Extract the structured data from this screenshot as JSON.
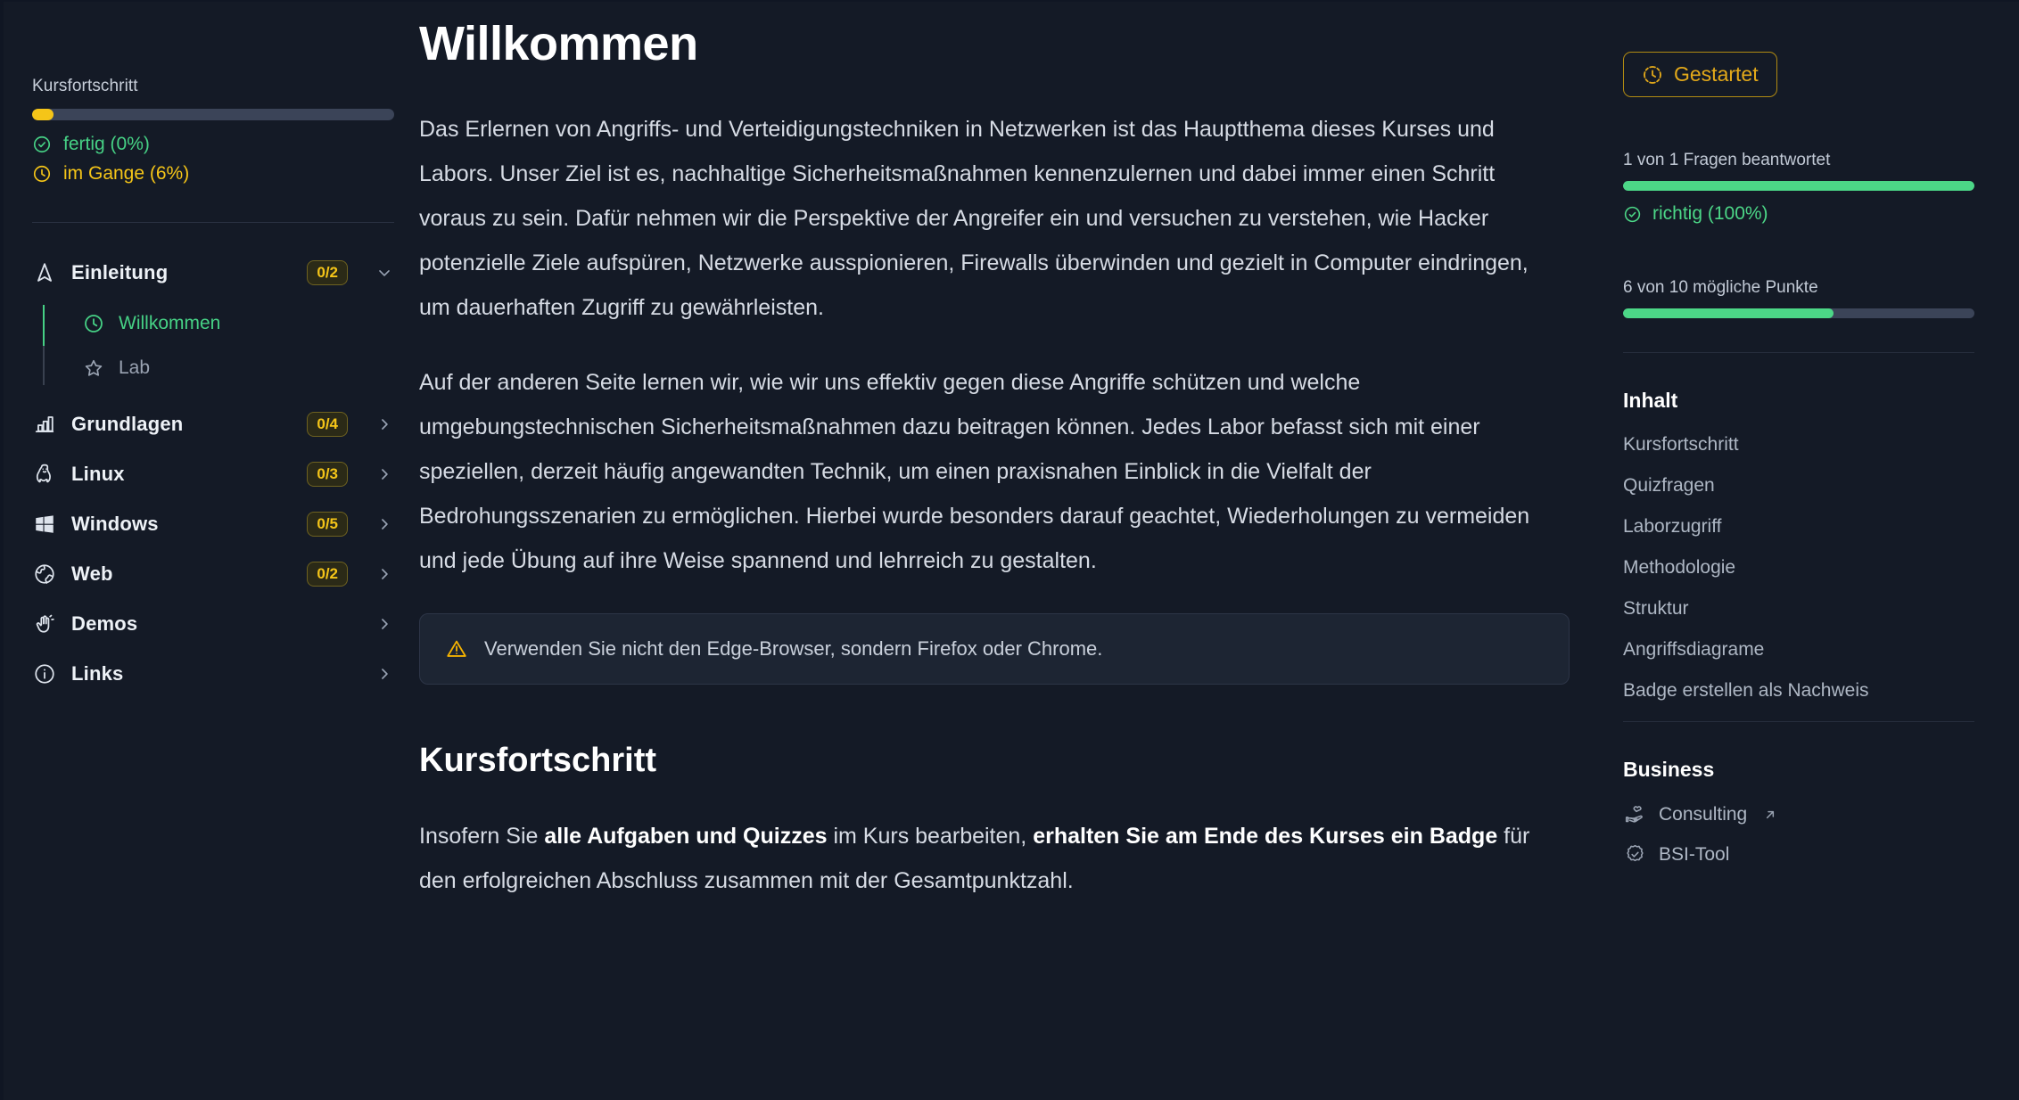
{
  "course_progress": {
    "label": "Kursfortschritt",
    "bar_percent": 6,
    "done_text": "fertig (0%)",
    "inprogress_text": "im Gange (6%)",
    "done_icon": "check-circle-icon",
    "inprogress_icon": "clock-icon",
    "colors": {
      "done": "#46d185",
      "inprogress": "#f5c518",
      "track": "#3b4458"
    }
  },
  "nav": {
    "items": [
      {
        "label": "Einleitung",
        "icon": "navigation-arrow-icon",
        "count": "0/2",
        "chevron": "chevron-down-icon",
        "expanded": true,
        "children": [
          {
            "label": "Willkommen",
            "icon": "clock-icon",
            "state": "active"
          },
          {
            "label": "Lab",
            "icon": "star-icon",
            "state": "idle"
          }
        ]
      },
      {
        "label": "Grundlagen",
        "icon": "bar-chart-icon",
        "count": "0/4",
        "chevron": "chevron-right-icon",
        "expanded": false
      },
      {
        "label": "Linux",
        "icon": "linux-penguin-icon",
        "count": "0/3",
        "chevron": "chevron-right-icon",
        "expanded": false
      },
      {
        "label": "Windows",
        "icon": "windows-logo-icon",
        "count": "0/5",
        "chevron": "chevron-right-icon",
        "expanded": false
      },
      {
        "label": "Web",
        "icon": "globe-icon",
        "count": "0/2",
        "chevron": "chevron-right-icon",
        "expanded": false
      },
      {
        "label": "Demos",
        "icon": "waving-hand-icon",
        "count": "",
        "chevron": "chevron-right-icon",
        "expanded": false
      },
      {
        "label": "Links",
        "icon": "info-circle-icon",
        "count": "",
        "chevron": "chevron-right-icon",
        "expanded": false
      }
    ]
  },
  "main": {
    "title": "Willkommen",
    "paragraph1": "Das Erlernen von Angriffs- und Verteidigungstechniken in Netzwerken ist das Hauptthema dieses Kurses und Labors. Unser Ziel ist es, nachhaltige Sicherheitsmaßnahmen kennenzulernen und dabei immer einen Schritt voraus zu sein. Dafür nehmen wir die Perspektive der Angreifer ein und versuchen zu verstehen, wie Hacker potenzielle Ziele aufspüren, Netzwerke ausspionieren, Firewalls überwinden und gezielt in Computer eindringen, um dauerhaften Zugriff zu gewährleisten.",
    "paragraph2": "Auf der anderen Seite lernen wir, wie wir uns effektiv gegen diese Angriffe schützen und welche umgebungstechnischen Sicherheitsmaßnahmen dazu beitragen können. Jedes Labor befasst sich mit einer speziellen, derzeit häufig angewandten Technik, um einen praxisnahen Einblick in die Vielfalt der Bedrohungsszenarien zu ermöglichen. Hierbei wurde besonders darauf geachtet, Wiederholungen zu vermeiden und jede Übung auf ihre Weise spannend und lehrreich zu gestalten.",
    "callout": {
      "icon": "warning-triangle-icon",
      "text": "Verwenden Sie nicht den Edge-Browser, sondern Firefox oder Chrome."
    },
    "section2_title": "Kursfortschritt",
    "section2_p_part1": "Insofern Sie ",
    "section2_p_bold1": "alle Aufgaben und Quizzes",
    "section2_p_part2": " im Kurs bearbeiten, ",
    "section2_p_bold2": "erhalten Sie am Ende des Kurses ein Badge",
    "section2_p_part3": " für den erfolgreichen Abschluss zusammen mit der Gesamtpunktzahl."
  },
  "right": {
    "status_badge": {
      "label": "Gestartet",
      "icon": "dashed-clock-icon",
      "color": "#e3a91a"
    },
    "questions_label": "1 von 1 Fragen beantwortet",
    "questions_percent": 100,
    "correct_text": "richtig (100%)",
    "correct_icon": "check-circle-icon",
    "points_label": "6 von 10 mögliche Punkte",
    "points_percent": 60,
    "toc_heading": "Inhalt",
    "toc_items": [
      "Kursfortschritt",
      "Quizfragen",
      "Laborzugriff",
      "Methodologie",
      "Struktur",
      "Angriffsdiagrame",
      "Badge erstellen als Nachweis"
    ],
    "business_heading": "Business",
    "business_items": [
      {
        "label": "Consulting",
        "icon": "hand-heart-icon",
        "external": true,
        "external_icon": "external-link-icon"
      },
      {
        "label": "BSI-Tool",
        "icon": "verified-badge-icon",
        "external": false
      }
    ]
  }
}
